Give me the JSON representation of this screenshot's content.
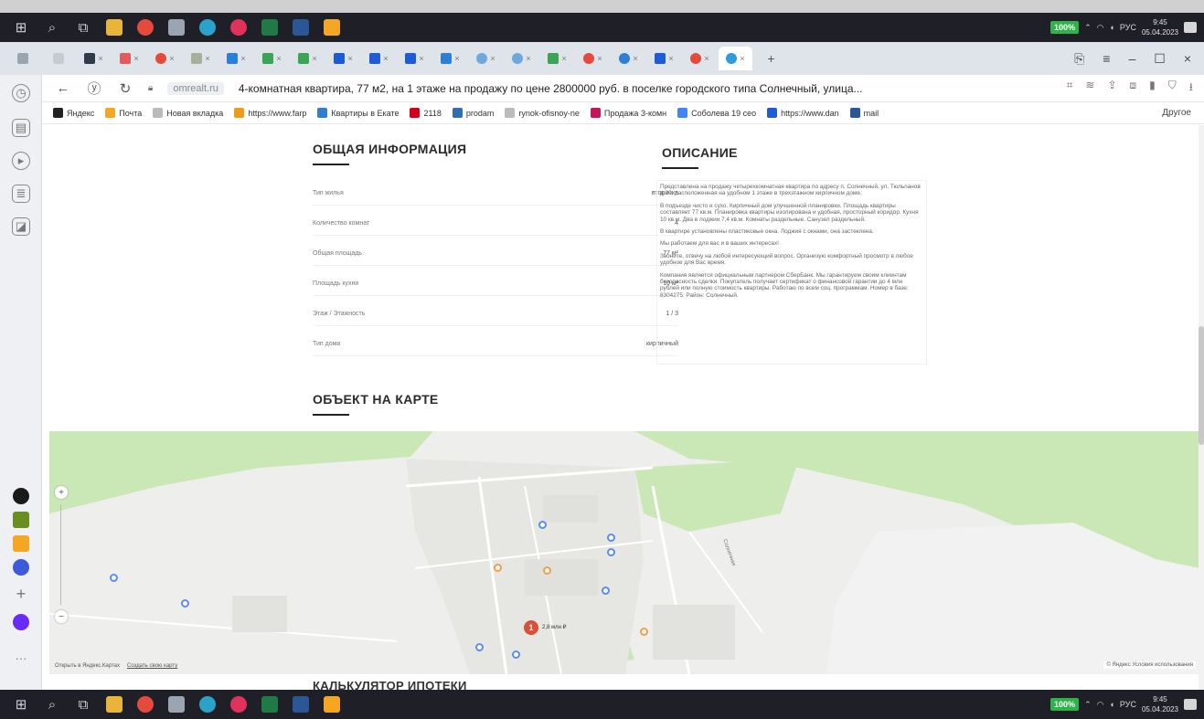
{
  "taskbar": {
    "battery": "100%",
    "lang": "РУС",
    "time": "9:45",
    "date": "05.04.2023"
  },
  "browser": {
    "url_domain": "omrealt.ru",
    "page_title": "4-комнатная квартира, 77 м2, на 1 этаже на продажу по цене 2800000 руб. в поселке городского типа Солнечный, улица...",
    "bookmarks": [
      {
        "label": "Яндекс",
        "color": "#222222"
      },
      {
        "label": "Почта",
        "color": "#f5a623"
      },
      {
        "label": "Новая вкладка",
        "color": "#bbbbbb"
      },
      {
        "label": "https://www.farp",
        "color": "#f09a1a"
      },
      {
        "label": "Квартиры в Екате",
        "color": "#2d7fd3"
      },
      {
        "label": "2118",
        "color": "#d0021b"
      },
      {
        "label": "prodam",
        "color": "#2f6db5"
      },
      {
        "label": "rynok-ofisnoy-ne",
        "color": "#bbbbbb"
      },
      {
        "label": "Продажа 3-комн",
        "color": "#c2185b"
      },
      {
        "label": "Соболева 19 сео",
        "color": "#4285f4"
      },
      {
        "label": "https://www.dan",
        "color": "#1e5bd6"
      },
      {
        "label": "mail",
        "color": "#2b5797"
      }
    ],
    "bookmarks_other": "Другое"
  },
  "general_info": {
    "title": "ОБЩАЯ ИНФОРМАЦИЯ",
    "rows": [
      {
        "label": "Тип жилья",
        "value": "вторичка"
      },
      {
        "label": "Количество комнат",
        "value": "4"
      },
      {
        "label": "Общая площадь",
        "value": "77 м²"
      },
      {
        "label": "Площадь кухни",
        "value": "10 м²"
      },
      {
        "label": "Этаж / Этажность",
        "value": "1 / 3"
      },
      {
        "label": "Тип дома",
        "value": "кирпичный"
      }
    ]
  },
  "description": {
    "title": "ОПИСАНИЕ",
    "paragraphs": [
      "Представлена на продажу четырехкомнатная квартира по адресу п. Солнечный, ул. Тюльпанов д.20, расположенная на удобном 1 этаже в трехэтажном кирпичном доме.",
      "В подъезде чисто и сухо. Кирпичный дом улучшенной планировки. Площадь квартиры составляет 77 кв.м. Планировка квартиры изолирована и удобная, просторный коридор. Кухня 10 кв.м. Два в лоджии 7,4 кв.м. Комнаты раздельные. Санузел раздельный.",
      "В квартире установлены пластиковые окна. Лоджия с окнами, она застеклена.",
      "Мы работаем для вас и в ваших интересах!",
      "Звоните, отвечу на любой интересующий вопрос. Организую комфортный просмотр в любое удобное для Вас время.",
      "Компания является официальным партнером СберБанк. Мы гарантируем своим клиентам безопасность сделки. Покупатель получает сертификат о финансовой гарантии до 4 млн рублей или полную стоимость квартиры. Работаю по всем соц. программам. Номер в базе: 8304275. Район: Солнечный."
    ]
  },
  "map": {
    "title": "ОБЪЕКТ НА КАРТЕ",
    "pin_count": "1",
    "pin_label": "2,8 млн ₽",
    "footer_left": [
      "Открыть в Яндекс.Картах",
      "Создать свою карту"
    ],
    "footer_right": "© Яндекс Условия использования",
    "street_label": "Солнечная"
  },
  "next_section": {
    "title": "КАЛЬКУЛЯТОР ИПОТЕКИ"
  }
}
